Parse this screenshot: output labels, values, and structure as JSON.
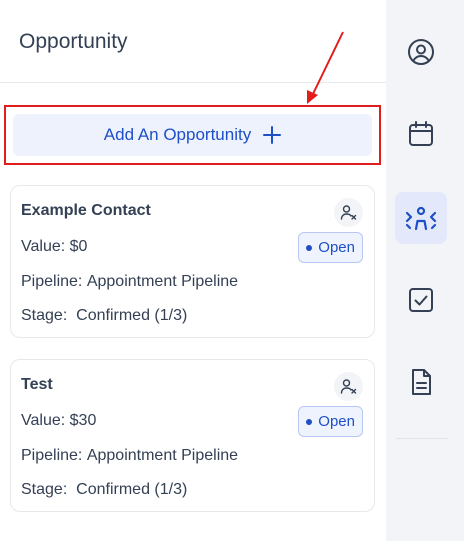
{
  "panel": {
    "title": "Opportunity"
  },
  "add_button": {
    "label": "Add An Opportunity"
  },
  "cards": [
    {
      "name": "Example Contact",
      "value_label": "Value:",
      "value": "$0",
      "status": "Open",
      "pipeline_label": "Pipeline:",
      "pipeline": "Appointment Pipeline",
      "stage_label": "Stage:",
      "stage": "Confirmed (1/3)"
    },
    {
      "name": "Test",
      "value_label": "Value:",
      "value": "$30",
      "status": "Open",
      "pipeline_label": "Pipeline:",
      "pipeline": "Appointment Pipeline",
      "stage_label": "Stage:",
      "stage": "Confirmed (1/3)"
    }
  ],
  "rail": {
    "items": [
      {
        "icon": "user-circle-icon"
      },
      {
        "icon": "calendar-icon"
      },
      {
        "icon": "opportunity-icon",
        "active": true
      },
      {
        "icon": "checkbox-icon"
      },
      {
        "icon": "document-icon"
      }
    ]
  },
  "colors": {
    "accent": "#1f4fc6",
    "highlight_box": "#e11d1d",
    "annotation_arrow": "#e11d1d"
  }
}
